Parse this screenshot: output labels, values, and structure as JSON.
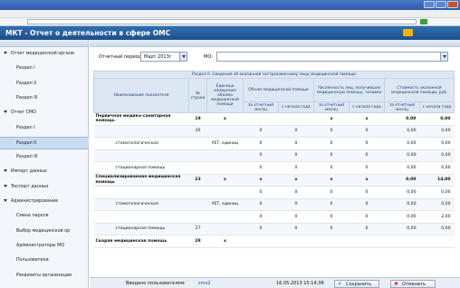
{
  "app": {
    "title": "МКТ - Отчет о деятельности в сфере ОМС",
    "colors": {
      "header": "#1d4f8a",
      "accent": "#2f6fb2",
      "save": "#3aa03a",
      "cancel": "#d0352a"
    }
  },
  "sidebar": {
    "items": [
      {
        "label": "Отчет медицинской органи",
        "kind": "group"
      },
      {
        "label": "Раздел I",
        "kind": "child"
      },
      {
        "label": "Раздел II",
        "kind": "child"
      },
      {
        "label": "Раздел III",
        "kind": "child"
      },
      {
        "label": "Отчет СМО",
        "kind": "group"
      },
      {
        "label": "Раздел I",
        "kind": "child"
      },
      {
        "label": "Раздел II",
        "kind": "child",
        "active": true
      },
      {
        "label": "Раздел III",
        "kind": "child"
      },
      {
        "label": "Импорт данных",
        "kind": "group"
      },
      {
        "label": "Экспорт данных",
        "kind": "group"
      },
      {
        "label": "Администрирование",
        "kind": "group"
      },
      {
        "label": "Смена пароля",
        "kind": "child"
      },
      {
        "label": "Выбор медицинской ор",
        "kind": "child"
      },
      {
        "label": "Администраторы МО",
        "kind": "child"
      },
      {
        "label": "Пользователи",
        "kind": "child"
      },
      {
        "label": "Реквизиты организации",
        "kind": "child"
      }
    ]
  },
  "filters": {
    "period_label": "Отчетный период:",
    "period_value": "Март 2013г",
    "mo_label": "МО:"
  },
  "table": {
    "section_title": "Раздел II. Сведения об оказанной застрахованному лицу медицинской помощи",
    "headers": {
      "name": "Наименование показателя",
      "row_no": "№ строки",
      "unit": "Единица измерения объема медицинской помощи",
      "volume": "Объем медицинской помощи",
      "persons": "Численность лиц, получивших медицинскую помощь, человек",
      "cost": "Стоимость оказанной медицинской помощи, руб.",
      "period": "за отчетный месяц",
      "ytd": "с начала года"
    },
    "rows": [
      {
        "name": "Первичная медико-санитарная помощь",
        "row_no": "19",
        "unit": "x",
        "v1": "",
        "v2": "",
        "p1": "x",
        "p2": "x",
        "c1": "0,00",
        "c2": "0,00",
        "bold": true
      },
      {
        "name": "",
        "row_no": "20",
        "unit": "",
        "v1": "0",
        "v2": "0",
        "p1": "0",
        "p2": "0",
        "c1": "0,00",
        "c2": "0,00"
      },
      {
        "name": "стоматологическая",
        "row_no": "",
        "unit": "УЕТ, единиц",
        "v1": "0",
        "v2": "0",
        "p1": "0",
        "p2": "0",
        "c1": "0,00",
        "c2": "0,00"
      },
      {
        "name": "",
        "row_no": "",
        "unit": "",
        "v1": "0",
        "v2": "0",
        "p1": "0",
        "p2": "0",
        "c1": "0,00",
        "c2": "0,00"
      },
      {
        "name": "стационарная помощь",
        "row_no": "",
        "unit": "",
        "v1": "0",
        "v2": "0",
        "p1": "0",
        "p2": "0",
        "c1": "0,00",
        "c2": "0,00"
      },
      {
        "name": "Специализированная медицинская помощь",
        "row_no": "23",
        "unit": "x",
        "v1": "x",
        "v2": "x",
        "p1": "x",
        "p2": "x",
        "c1": "0,00",
        "c2": "14,00",
        "bold": true
      },
      {
        "name": "",
        "row_no": "",
        "unit": "",
        "v1": "0",
        "v2": "0",
        "p1": "0",
        "p2": "0",
        "c1": "0,00",
        "c2": "0,00"
      },
      {
        "name": "стоматологическая",
        "row_no": "",
        "unit": "УЕТ, единиц",
        "v1": "0",
        "v2": "0",
        "p1": "0",
        "p2": "0",
        "c1": "0,00",
        "c2": "0,00"
      },
      {
        "name": "",
        "row_no": "",
        "unit": "",
        "v1": "0",
        "v2": "0",
        "p1": "0",
        "p2": "0",
        "c1": "0,00",
        "c2": "2,00"
      },
      {
        "name": "стационарная помощь",
        "row_no": "27",
        "unit": "",
        "v1": "0",
        "v2": "0",
        "p1": "0",
        "p2": "0",
        "c1": "0,00",
        "c2": "0,00"
      },
      {
        "name": "Скорая медицинская помощь",
        "row_no": "28",
        "unit": "x",
        "v1": "",
        "v2": "",
        "p1": "",
        "p2": "",
        "c1": "",
        "c2": "",
        "bold": true
      }
    ]
  },
  "status": {
    "entered_label": "Введено пользователем:",
    "entered_user": "smo2",
    "timestamp": "16.05.2013 15:14:38"
  },
  "buttons": {
    "save": "Сохранить",
    "cancel": "Отменить"
  }
}
